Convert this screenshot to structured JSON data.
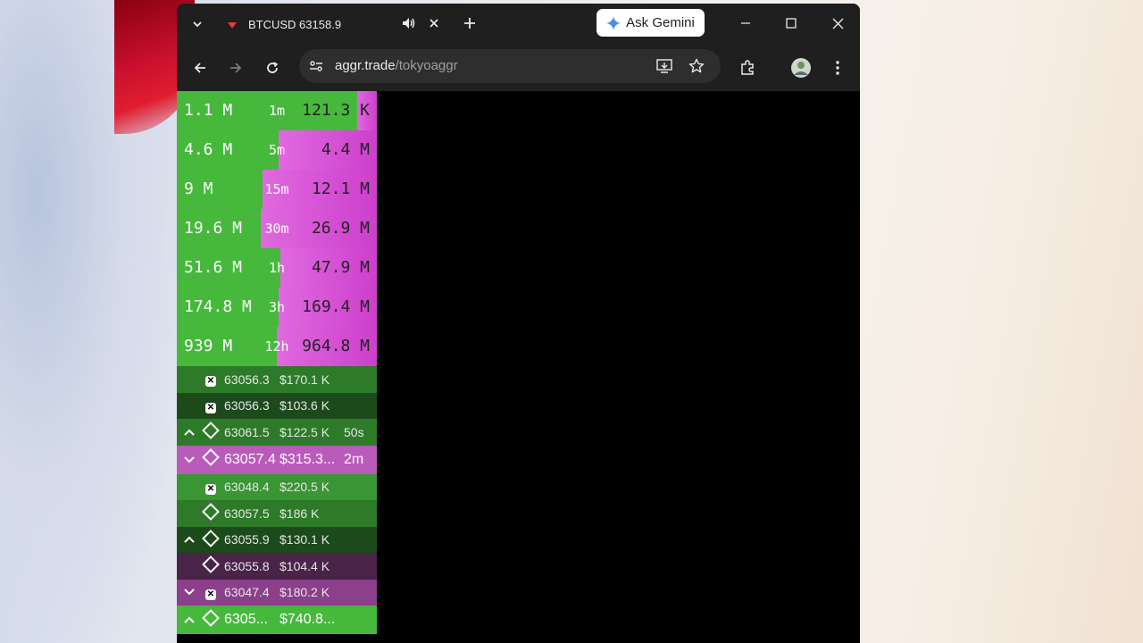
{
  "tab": {
    "title": "BTCUSD 63158.9",
    "gemini_label": "Ask Gemini"
  },
  "omnibox": {
    "host": "aggr.trade",
    "path": "/tokyoaggr"
  },
  "stats": [
    {
      "interval": "1m",
      "buy": "1.1 M",
      "sell": "121.3 K",
      "buy_ratio": 0.9
    },
    {
      "interval": "5m",
      "buy": "4.6 M",
      "sell": "4.4 M",
      "buy_ratio": 0.51
    },
    {
      "interval": "15m",
      "buy": "9 M",
      "sell": "12.1 M",
      "buy_ratio": 0.43
    },
    {
      "interval": "30m",
      "buy": "19.6 M",
      "sell": "26.9 M",
      "buy_ratio": 0.42
    },
    {
      "interval": "1h",
      "buy": "51.6 M",
      "sell": "47.9 M",
      "buy_ratio": 0.52
    },
    {
      "interval": "3h",
      "buy": "174.8 M",
      "sell": "169.4 M",
      "buy_ratio": 0.51
    },
    {
      "interval": "12h",
      "buy": "939 M",
      "sell": "964.8 M",
      "buy_ratio": 0.5
    }
  ],
  "trades": [
    {
      "arrow": "",
      "exchange": "x-icon",
      "price": "63056.3",
      "amount": "$170.1 K",
      "age": "",
      "bg": "#2d7a29",
      "big": false
    },
    {
      "arrow": "",
      "exchange": "x-icon",
      "price": "63056.3",
      "amount": "$103.6 K",
      "age": "",
      "bg": "#1d4a1b",
      "big": false
    },
    {
      "arrow": "up",
      "exchange": "binance-icon",
      "price": "63061.5",
      "amount": "$122.5 K",
      "age": "50s",
      "bg": "#2d7a29",
      "big": false
    },
    {
      "arrow": "down",
      "exchange": "binance-icon",
      "price": "63057.4",
      "amount": "$315.3...",
      "age": "2m",
      "bg": "#b95bb9",
      "big": true
    },
    {
      "arrow": "",
      "exchange": "x-icon",
      "price": "63048.4",
      "amount": "$220.5 K",
      "age": "",
      "bg": "#3a9534",
      "big": false
    },
    {
      "arrow": "",
      "exchange": "binance-icon",
      "price": "63057.5",
      "amount": "$186 K",
      "age": "",
      "bg": "#2d7a29",
      "big": false
    },
    {
      "arrow": "up",
      "exchange": "binance-icon",
      "price": "63055.9",
      "amount": "$130.1 K",
      "age": "",
      "bg": "#1d4a1b",
      "big": false
    },
    {
      "arrow": "",
      "exchange": "binance-icon",
      "price": "63055.8",
      "amount": "$104.4 K",
      "age": "",
      "bg": "#4a2348",
      "big": false
    },
    {
      "arrow": "down",
      "exchange": "x-icon",
      "price": "63047.4",
      "amount": "$180.2 K",
      "age": "",
      "bg": "#8c3f8a",
      "big": false
    },
    {
      "arrow": "up",
      "exchange": "binance-icon",
      "price": "6305...",
      "amount": "$740.8...",
      "age": "",
      "bg": "#46b83c",
      "big": true
    }
  ]
}
